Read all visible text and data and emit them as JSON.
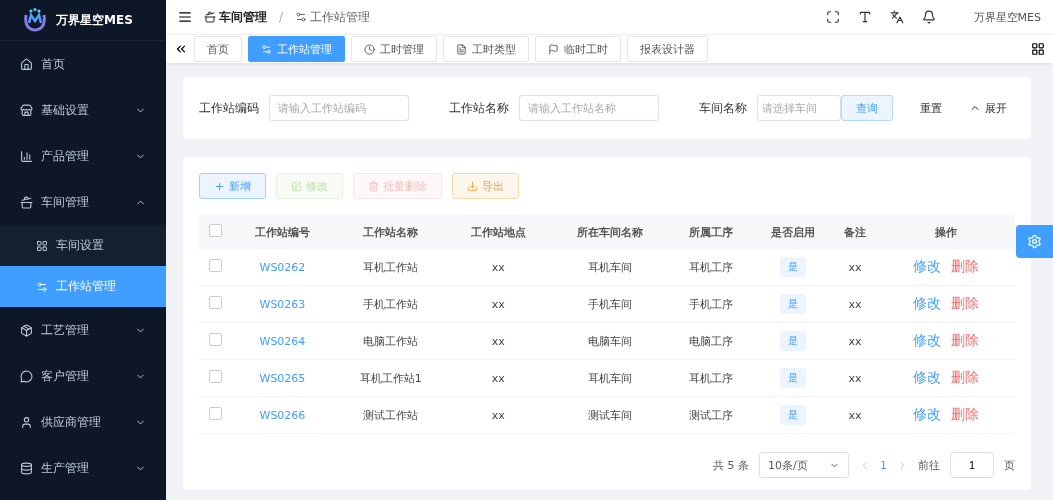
{
  "brand": {
    "name": "万界星空MES"
  },
  "sidebar": {
    "items": [
      {
        "label": "首页",
        "kind": "link",
        "selected": false
      },
      {
        "label": "基础设置",
        "kind": "group",
        "expanded": false
      },
      {
        "label": "产品管理",
        "kind": "group",
        "expanded": false
      },
      {
        "label": "车间管理",
        "kind": "group",
        "expanded": true,
        "children": [
          {
            "label": "车间设置",
            "selected": false
          },
          {
            "label": "工作站管理",
            "selected": true
          }
        ]
      },
      {
        "label": "工艺管理",
        "kind": "group",
        "expanded": false
      },
      {
        "label": "客户管理",
        "kind": "group",
        "expanded": false
      },
      {
        "label": "供应商管理",
        "kind": "group",
        "expanded": false
      },
      {
        "label": "生产管理",
        "kind": "group",
        "expanded": false
      }
    ]
  },
  "header": {
    "breadcrumb": [
      "车间管理",
      "工作站管理"
    ],
    "separator": "/",
    "user": "万界星空MES"
  },
  "tabs": [
    {
      "label": "首页",
      "selected": false
    },
    {
      "label": "工作站管理",
      "selected": true
    },
    {
      "label": "工时管理",
      "selected": false
    },
    {
      "label": "工时类型",
      "selected": false
    },
    {
      "label": "临时工时",
      "selected": false
    },
    {
      "label": "报表设计器",
      "selected": false
    }
  ],
  "search": {
    "fields": [
      {
        "label": "工作站编码",
        "placeholder": "请输入工作站编码",
        "kind": "input"
      },
      {
        "label": "工作站名称",
        "placeholder": "请输入工作站名称",
        "kind": "input"
      },
      {
        "label": "车间名称",
        "placeholder": "请选择车间",
        "kind": "select"
      }
    ],
    "query": "查询",
    "reset": "重置",
    "expand": "展开"
  },
  "toolbar": [
    {
      "label": "新增",
      "kind": "add",
      "disabled": false
    },
    {
      "label": "修改",
      "kind": "edit",
      "disabled": true
    },
    {
      "label": "批量删除",
      "kind": "delete",
      "disabled": true
    },
    {
      "label": "导出",
      "kind": "export",
      "disabled": false
    }
  ],
  "table": {
    "all_checked": false,
    "columns": [
      "工作站编号",
      "工作站名称",
      "工作站地点",
      "所在车间名称",
      "所属工序",
      "是否启用",
      "备注",
      "操作"
    ],
    "rows": [
      {
        "checked": false,
        "code": "WS0262",
        "name": "耳机工作站",
        "location": "xx",
        "workshop": "耳机车间",
        "process": "耳机工序",
        "enabled": "是",
        "note": "xx",
        "actions": [
          "修改",
          "删除"
        ]
      },
      {
        "checked": false,
        "code": "WS0263",
        "name": "手机工作站",
        "location": "xx",
        "workshop": "手机车间",
        "process": "手机工序",
        "enabled": "是",
        "note": "xx",
        "actions": [
          "修改",
          "删除"
        ]
      },
      {
        "checked": false,
        "code": "WS0264",
        "name": "电脑工作站",
        "location": "xx",
        "workshop": "电脑车间",
        "process": "电脑工序",
        "enabled": "是",
        "note": "xx",
        "actions": [
          "修改",
          "删除"
        ]
      },
      {
        "checked": false,
        "code": "WS0265",
        "name": "耳机工作站1",
        "location": "xx",
        "workshop": "耳机车间",
        "process": "耳机工序",
        "enabled": "是",
        "note": "xx",
        "actions": [
          "修改",
          "删除"
        ]
      },
      {
        "checked": false,
        "code": "WS0266",
        "name": "测试工作站",
        "location": "xx",
        "workshop": "测试车间",
        "process": "测试工序",
        "enabled": "是",
        "note": "xx",
        "actions": [
          "修改",
          "删除"
        ]
      }
    ]
  },
  "pagination": {
    "total": "共 5 条",
    "size": "10条/页",
    "pages": [
      {
        "label": "1",
        "selected": true
      }
    ],
    "goto": "前往",
    "page": "1",
    "unit": "页"
  }
}
